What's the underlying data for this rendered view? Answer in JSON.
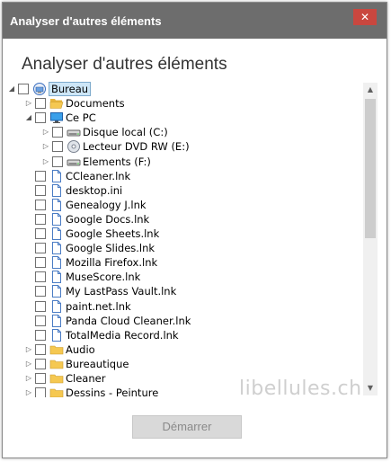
{
  "window": {
    "title": "Analyser d'autres éléments",
    "close_glyph": "✕"
  },
  "heading": "Analyser d'autres éléments",
  "tree": [
    {
      "label": "Bureau",
      "icon": "desktop-icon",
      "expander": "expanded",
      "depth": 0,
      "selected": true
    },
    {
      "label": "Documents",
      "icon": "folder-open-icon",
      "expander": "collapsed",
      "depth": 1
    },
    {
      "label": "Ce PC",
      "icon": "computer-icon",
      "expander": "expanded",
      "depth": 1
    },
    {
      "label": "Disque local (C:)",
      "icon": "drive-icon",
      "expander": "collapsed",
      "depth": 2
    },
    {
      "label": "Lecteur DVD RW (E:)",
      "icon": "dvd-icon",
      "expander": "collapsed",
      "depth": 2
    },
    {
      "label": "Elements (F:)",
      "icon": "drive-icon",
      "expander": "collapsed",
      "depth": 2
    },
    {
      "label": "CCleaner.lnk",
      "icon": "file-icon",
      "expander": "none",
      "depth": 1
    },
    {
      "label": "desktop.ini",
      "icon": "file-icon",
      "expander": "none",
      "depth": 1
    },
    {
      "label": "Genealogy J.lnk",
      "icon": "file-icon",
      "expander": "none",
      "depth": 1
    },
    {
      "label": "Google Docs.lnk",
      "icon": "file-icon",
      "expander": "none",
      "depth": 1
    },
    {
      "label": "Google Sheets.lnk",
      "icon": "file-icon",
      "expander": "none",
      "depth": 1
    },
    {
      "label": "Google Slides.lnk",
      "icon": "file-icon",
      "expander": "none",
      "depth": 1
    },
    {
      "label": "Mozilla Firefox.lnk",
      "icon": "file-icon",
      "expander": "none",
      "depth": 1
    },
    {
      "label": "MuseScore.lnk",
      "icon": "file-icon",
      "expander": "none",
      "depth": 1
    },
    {
      "label": "My LastPass Vault.lnk",
      "icon": "file-icon",
      "expander": "none",
      "depth": 1
    },
    {
      "label": "paint.net.lnk",
      "icon": "file-icon",
      "expander": "none",
      "depth": 1
    },
    {
      "label": "Panda Cloud Cleaner.lnk",
      "icon": "file-icon",
      "expander": "none",
      "depth": 1
    },
    {
      "label": "TotalMedia Record.lnk",
      "icon": "file-icon",
      "expander": "none",
      "depth": 1
    },
    {
      "label": "Audio",
      "icon": "folder-icon",
      "expander": "collapsed",
      "depth": 1
    },
    {
      "label": "Bureautique",
      "icon": "folder-icon",
      "expander": "collapsed",
      "depth": 1
    },
    {
      "label": "Cleaner",
      "icon": "folder-icon",
      "expander": "collapsed",
      "depth": 1
    },
    {
      "label": "Dessins - Peinture",
      "icon": "folder-icon",
      "expander": "collapsed",
      "depth": 1
    }
  ],
  "watermark": "libellules.ch",
  "start_button": "Démarrer",
  "colors": {
    "titlebar": "#6d6d6d",
    "close": "#c9473f",
    "selection": "#cde6f7",
    "folder": "#f5c851",
    "file_outline": "#4a7cc4",
    "disabled_text": "#8a8a8a"
  }
}
